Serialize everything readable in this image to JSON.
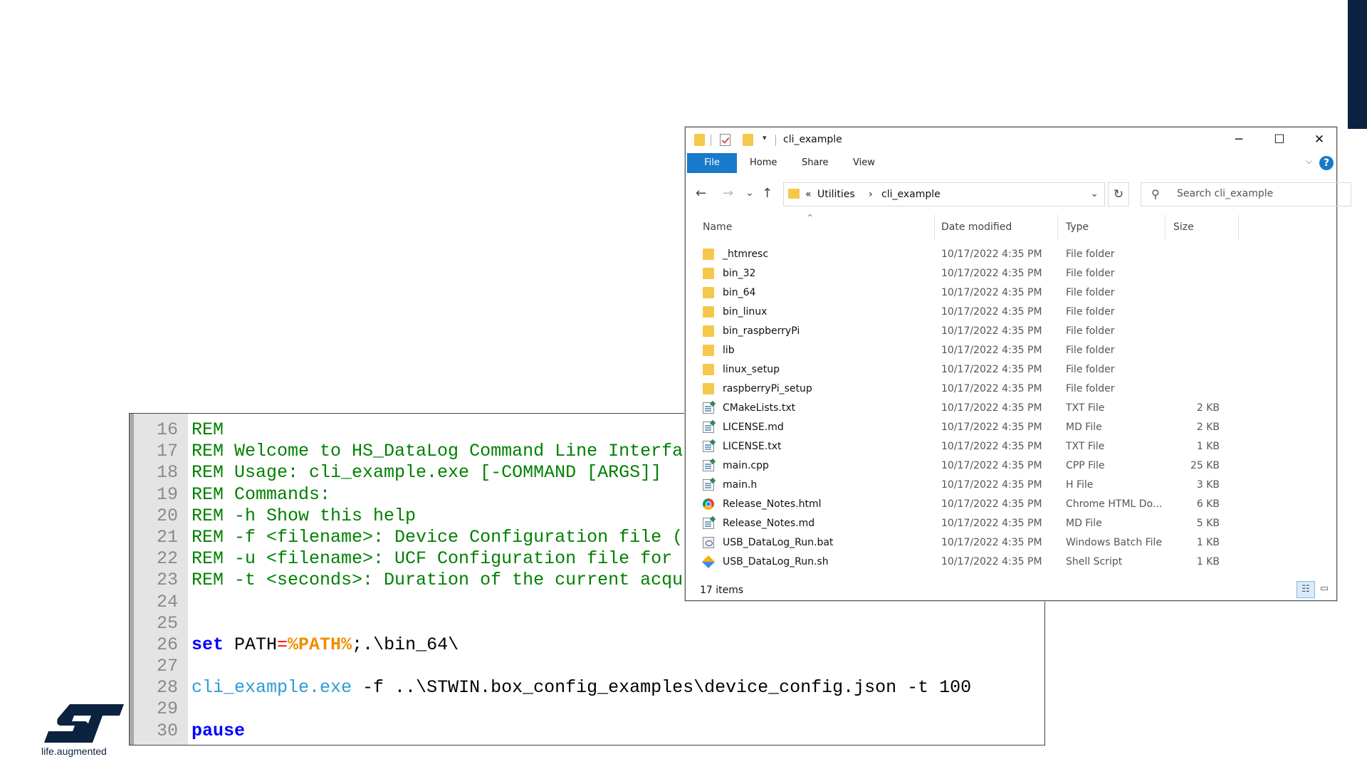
{
  "editor": {
    "lines": [
      {
        "num": "16",
        "segments": [
          {
            "cls": "c-rem",
            "text": "REM"
          }
        ]
      },
      {
        "num": "17",
        "segments": [
          {
            "cls": "c-rem",
            "text": "REM Welcome to HS_DataLog Command Line Interfa"
          }
        ]
      },
      {
        "num": "18",
        "segments": [
          {
            "cls": "c-rem",
            "text": "REM Usage: cli_example.exe [-COMMAND [ARGS]]"
          }
        ]
      },
      {
        "num": "19",
        "segments": [
          {
            "cls": "c-rem",
            "text": "REM Commands:"
          }
        ]
      },
      {
        "num": "20",
        "segments": [
          {
            "cls": "c-rem",
            "text": "REM -h Show this help"
          }
        ]
      },
      {
        "num": "21",
        "segments": [
          {
            "cls": "c-rem",
            "text": "REM -f <filename>: Device Configuration file ("
          }
        ]
      },
      {
        "num": "22",
        "segments": [
          {
            "cls": "c-rem",
            "text": "REM -u <filename>: UCF Configuration file for"
          }
        ]
      },
      {
        "num": "23",
        "segments": [
          {
            "cls": "c-rem",
            "text": "REM -t <seconds>: Duration of the current acqu"
          }
        ]
      },
      {
        "num": "24",
        "segments": []
      },
      {
        "num": "25",
        "segments": []
      },
      {
        "num": "26",
        "segments": [
          {
            "cls": "c-kw",
            "text": "set"
          },
          {
            "cls": "c-plain",
            "text": " PATH"
          },
          {
            "cls": "c-op",
            "text": "="
          },
          {
            "cls": "c-var",
            "text": "%PATH%"
          },
          {
            "cls": "c-plain",
            "text": ";.\\bin_64\\"
          }
        ]
      },
      {
        "num": "27",
        "segments": []
      },
      {
        "num": "28",
        "segments": [
          {
            "cls": "c-exe",
            "text": "cli_example.exe"
          },
          {
            "cls": "c-plain",
            "text": " -f ..\\STWIN.box_config_examples\\device_config.json -t 100"
          }
        ]
      },
      {
        "num": "29",
        "segments": []
      },
      {
        "num": "30",
        "segments": [
          {
            "cls": "c-kw",
            "text": "pause"
          }
        ]
      }
    ]
  },
  "logo": {
    "tagline": "life.augmented",
    "color": "#0b2240"
  },
  "explorer": {
    "title": "cli_example",
    "quick_access_dropdown": "▾",
    "window_buttons": {
      "minimize": "─",
      "maximize": "☐",
      "close": "✕"
    },
    "ribbon": {
      "file": "File",
      "home": "Home",
      "share": "Share",
      "view": "View",
      "collapse": "⌵",
      "help": "?"
    },
    "nav": {
      "back": "←",
      "forward": "→",
      "recent": "⌄",
      "up": "↑",
      "refresh": "↻"
    },
    "address": {
      "overflow": "«",
      "crumbs": [
        "Utilities",
        "cli_example"
      ],
      "separator": "›",
      "dropdown": "⌄"
    },
    "search": {
      "placeholder": "Search cli_example",
      "icon": "⚲"
    },
    "columns": {
      "name": "Name",
      "date": "Date modified",
      "type": "Type",
      "size": "Size",
      "sort_caret": "^"
    },
    "files": [
      {
        "icon": "folder",
        "name": "_htmresc",
        "date": "10/17/2022 4:35 PM",
        "type": "File folder",
        "size": ""
      },
      {
        "icon": "folder",
        "name": "bin_32",
        "date": "10/17/2022 4:35 PM",
        "type": "File folder",
        "size": ""
      },
      {
        "icon": "folder",
        "name": "bin_64",
        "date": "10/17/2022 4:35 PM",
        "type": "File folder",
        "size": ""
      },
      {
        "icon": "folder",
        "name": "bin_linux",
        "date": "10/17/2022 4:35 PM",
        "type": "File folder",
        "size": ""
      },
      {
        "icon": "folder",
        "name": "bin_raspberryPi",
        "date": "10/17/2022 4:35 PM",
        "type": "File folder",
        "size": ""
      },
      {
        "icon": "folder",
        "name": "lib",
        "date": "10/17/2022 4:35 PM",
        "type": "File folder",
        "size": ""
      },
      {
        "icon": "folder",
        "name": "linux_setup",
        "date": "10/17/2022 4:35 PM",
        "type": "File folder",
        "size": ""
      },
      {
        "icon": "folder",
        "name": "raspberryPi_setup",
        "date": "10/17/2022 4:35 PM",
        "type": "File folder",
        "size": ""
      },
      {
        "icon": "file",
        "name": "CMakeLists.txt",
        "date": "10/17/2022 4:35 PM",
        "type": "TXT File",
        "size": "2 KB"
      },
      {
        "icon": "file",
        "name": "LICENSE.md",
        "date": "10/17/2022 4:35 PM",
        "type": "MD File",
        "size": "2 KB"
      },
      {
        "icon": "file",
        "name": "LICENSE.txt",
        "date": "10/17/2022 4:35 PM",
        "type": "TXT File",
        "size": "1 KB"
      },
      {
        "icon": "file",
        "name": "main.cpp",
        "date": "10/17/2022 4:35 PM",
        "type": "CPP File",
        "size": "25 KB"
      },
      {
        "icon": "file",
        "name": "main.h",
        "date": "10/17/2022 4:35 PM",
        "type": "H File",
        "size": "3 KB"
      },
      {
        "icon": "chrome",
        "name": "Release_Notes.html",
        "date": "10/17/2022 4:35 PM",
        "type": "Chrome HTML Do...",
        "size": "6 KB"
      },
      {
        "icon": "file",
        "name": "Release_Notes.md",
        "date": "10/17/2022 4:35 PM",
        "type": "MD File",
        "size": "5 KB"
      },
      {
        "icon": "bat",
        "name": "USB_DataLog_Run.bat",
        "date": "10/17/2022 4:35 PM",
        "type": "Windows Batch File",
        "size": "1 KB"
      },
      {
        "icon": "sh",
        "name": "USB_DataLog_Run.sh",
        "date": "10/17/2022 4:35 PM",
        "type": "Shell Script",
        "size": "1 KB"
      }
    ],
    "status": "17 items",
    "view_icons": {
      "details": "☷",
      "tiles": "▭"
    }
  }
}
